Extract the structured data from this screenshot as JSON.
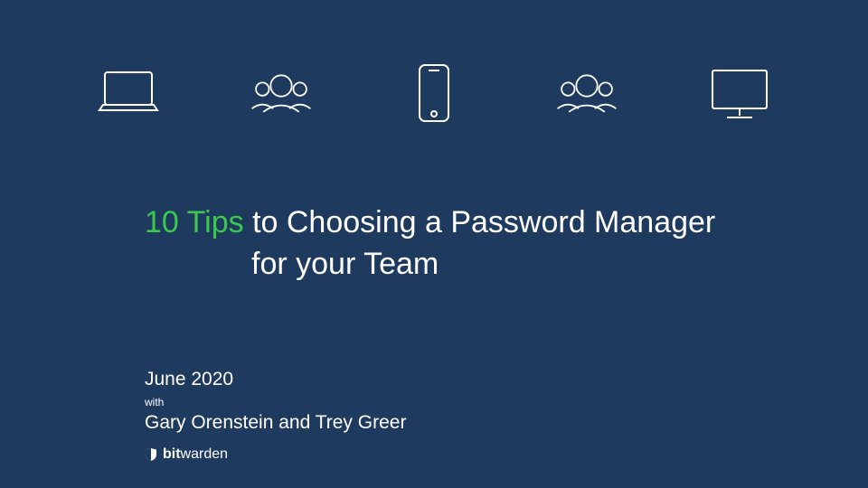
{
  "title": {
    "highlight": "10 Tips",
    "rest1": " to Choosing a Password Manager",
    "line2": "for your Team"
  },
  "date": "June 2020",
  "with_label": "with",
  "authors": "Gary Orenstein and Trey Greer",
  "brand": {
    "bold": "bit",
    "light": "warden"
  },
  "icons": [
    {
      "name": "laptop-icon"
    },
    {
      "name": "people-icon"
    },
    {
      "name": "smartphone-icon"
    },
    {
      "name": "people-icon"
    },
    {
      "name": "desktop-monitor-icon"
    }
  ],
  "colors": {
    "background": "#1f3a5f",
    "accent": "#3cc84c",
    "text": "#ffffff"
  }
}
